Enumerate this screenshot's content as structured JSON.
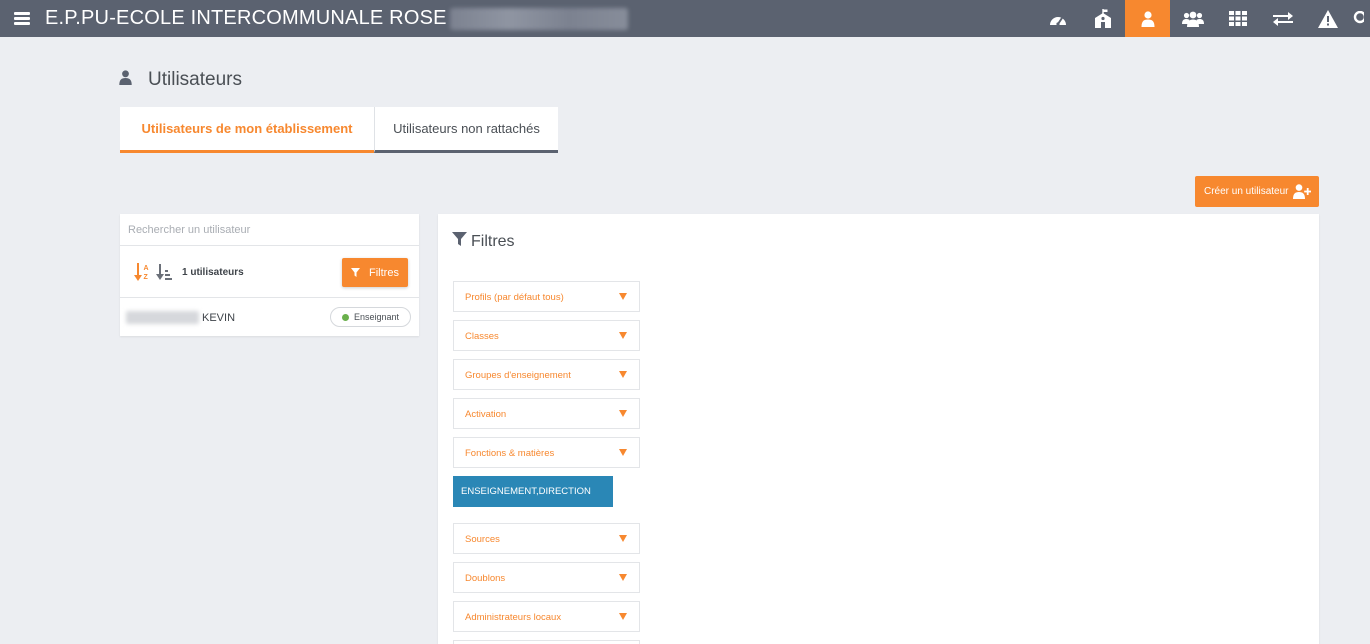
{
  "topbar": {
    "title": "E.P.PU-ECOLE INTERCOMMUNALE ROSE",
    "menu_icon": "hamburger-menu-icon",
    "icons": [
      "dashboard-gauge-icon",
      "school-building-icon",
      "user-icon",
      "users-group-icon",
      "grid-icon",
      "transfer-arrows-icon",
      "warning-icon"
    ],
    "active_icon": "user-icon",
    "accent_color": "#f7882f",
    "bar_color": "#5b6270"
  },
  "page": {
    "title": "Utilisateurs",
    "title_icon": "user-icon"
  },
  "tabs": [
    {
      "label": "Utilisateurs de mon établissement",
      "active": true
    },
    {
      "label": "Utilisateurs non rattachés",
      "active": false
    }
  ],
  "create_button": {
    "label": "Créer un utilisateur",
    "icon": "add-user-icon"
  },
  "user_list": {
    "search_placeholder": "Rechercher un utilisateur",
    "count_label": "1 utilisateurs",
    "filter_button": "Filtres",
    "sort_icons": [
      "sort-alpha-icon",
      "sort-numeric-icon"
    ],
    "users": [
      {
        "name": "KEVIN",
        "badge": "Enseignant",
        "badge_color": "#6ab04c"
      }
    ]
  },
  "filters": {
    "title": "Filtres",
    "title_icon": "funnel-icon",
    "items": [
      {
        "label": "Profils (par défaut tous)"
      },
      {
        "label": "Classes"
      },
      {
        "label": "Groupes d'enseignement"
      },
      {
        "label": "Activation"
      },
      {
        "label": "Fonctions & matières"
      },
      {
        "label": "Sources"
      },
      {
        "label": "Doublons"
      },
      {
        "label": "Administrateurs locaux"
      }
    ],
    "selected_chip": "ENSEIGNEMENT,DIRECTION",
    "chip_color": "#2a87b6"
  }
}
